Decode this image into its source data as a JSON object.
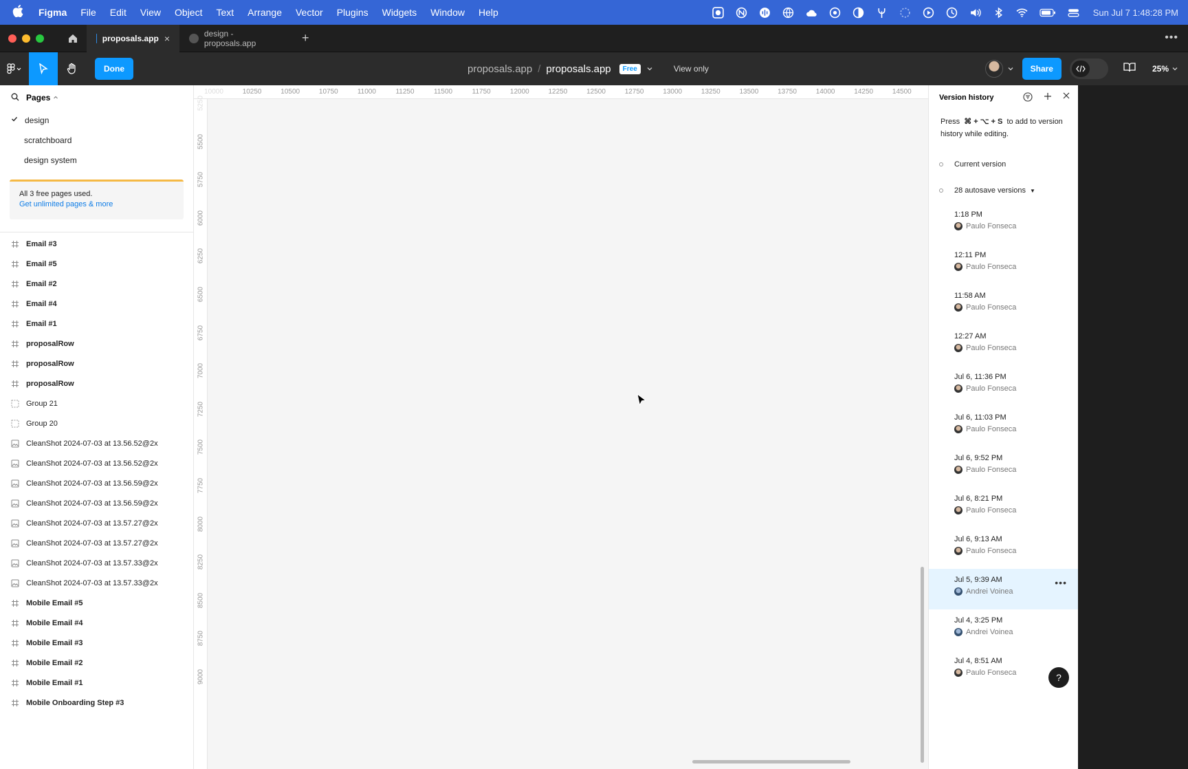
{
  "menubar": {
    "app": "Figma",
    "items": [
      "File",
      "Edit",
      "View",
      "Object",
      "Text",
      "Arrange",
      "Vector",
      "Plugins",
      "Widgets",
      "Window",
      "Help"
    ],
    "clock": "Sun Jul 7  1:48:28 PM",
    "tray_icons": [
      "record-icon",
      "vpn-icon",
      "audio-icon",
      "globe-icon",
      "cloud-icon",
      "aperture-icon",
      "contrast-icon",
      "fork-icon",
      "loading-icon",
      "play-icon",
      "clock-icon",
      "volume-icon",
      "bluetooth-icon",
      "wifi-icon",
      "battery-icon",
      "control-center-icon"
    ]
  },
  "tabs": {
    "active": "proposals.app",
    "inactive": "design - proposals.app",
    "close_glyph": "×",
    "add_glyph": "+",
    "more_glyph": "•••"
  },
  "toolbar": {
    "done_label": "Done",
    "team": "proposals.app",
    "separator": "/",
    "file_name": "proposals.app",
    "plan_badge": "Free",
    "view_mode": "View only",
    "share_label": "Share",
    "zoom": "25%",
    "accent": "#0d99ff"
  },
  "left": {
    "pages_title": "Pages",
    "pages": [
      {
        "name": "design",
        "current": true
      },
      {
        "name": "scratchboard",
        "current": false
      },
      {
        "name": "design system",
        "current": false
      }
    ],
    "upgrade_text": "All 3 free pages used.",
    "upgrade_link": "Get unlimited pages & more",
    "layers": [
      {
        "name": "Email #3",
        "type": "frame"
      },
      {
        "name": "Email #5",
        "type": "frame"
      },
      {
        "name": "Email #2",
        "type": "frame"
      },
      {
        "name": "Email #4",
        "type": "frame"
      },
      {
        "name": "Email #1",
        "type": "frame"
      },
      {
        "name": "proposalRow",
        "type": "frame"
      },
      {
        "name": "proposalRow",
        "type": "frame"
      },
      {
        "name": "proposalRow",
        "type": "frame"
      },
      {
        "name": "Group 21",
        "type": "group"
      },
      {
        "name": "Group 20",
        "type": "group"
      },
      {
        "name": "CleanShot 2024-07-03 at 13.56.52@2x",
        "type": "image"
      },
      {
        "name": "CleanShot 2024-07-03 at 13.56.52@2x",
        "type": "image"
      },
      {
        "name": "CleanShot 2024-07-03 at 13.56.59@2x",
        "type": "image"
      },
      {
        "name": "CleanShot 2024-07-03 at 13.56.59@2x",
        "type": "image"
      },
      {
        "name": "CleanShot 2024-07-03 at 13.57.27@2x",
        "type": "image"
      },
      {
        "name": "CleanShot 2024-07-03 at 13.57.27@2x",
        "type": "image"
      },
      {
        "name": "CleanShot 2024-07-03 at 13.57.33@2x",
        "type": "image"
      },
      {
        "name": "CleanShot 2024-07-03 at 13.57.33@2x",
        "type": "image"
      },
      {
        "name": "Mobile Email #5",
        "type": "frame"
      },
      {
        "name": "Mobile Email #4",
        "type": "frame"
      },
      {
        "name": "Mobile Email #3",
        "type": "frame"
      },
      {
        "name": "Mobile Email #2",
        "type": "frame"
      },
      {
        "name": "Mobile Email #1",
        "type": "frame"
      },
      {
        "name": "Mobile Onboarding Step #3",
        "type": "frame"
      }
    ]
  },
  "canvas": {
    "ruler_x": [
      "10000",
      "10250",
      "10500",
      "10750",
      "11000",
      "11250",
      "11500",
      "11750",
      "12000",
      "12250",
      "12500",
      "12750",
      "13000",
      "13250",
      "13500",
      "13750",
      "14000",
      "14250",
      "14500"
    ],
    "ruler_y": [
      "5250",
      "5500",
      "5750",
      "6000",
      "6250",
      "6500",
      "6750",
      "7000",
      "7250",
      "7500",
      "7750",
      "8000",
      "8250",
      "8500",
      "8750",
      "9000"
    ]
  },
  "right": {
    "title": "Version history",
    "hint_pre": "Press",
    "hint_keys": "⌘ + ⌥ + S",
    "hint_post": "to add to version history while editing.",
    "current_version": "Current version",
    "autosave": "28 autosave versions",
    "versions": [
      {
        "time": "1:18 PM",
        "user": "Paulo Fonseca",
        "highlight": false
      },
      {
        "time": "12:11 PM",
        "user": "Paulo Fonseca",
        "highlight": false
      },
      {
        "time": "11:58 AM",
        "user": "Paulo Fonseca",
        "highlight": false
      },
      {
        "time": "12:27 AM",
        "user": "Paulo Fonseca",
        "highlight": false
      },
      {
        "time": "Jul 6, 11:36 PM",
        "user": "Paulo Fonseca",
        "highlight": false
      },
      {
        "time": "Jul 6, 11:03 PM",
        "user": "Paulo Fonseca",
        "highlight": false
      },
      {
        "time": "Jul 6, 9:52 PM",
        "user": "Paulo Fonseca",
        "highlight": false
      },
      {
        "time": "Jul 6, 8:21 PM",
        "user": "Paulo Fonseca",
        "highlight": false
      },
      {
        "time": "Jul 6, 9:13 AM",
        "user": "Paulo Fonseca",
        "highlight": false
      },
      {
        "time": "Jul 5, 9:39 AM",
        "user": "Andrei Voinea",
        "highlight": true
      },
      {
        "time": "Jul 4, 3:25 PM",
        "user": "Andrei Voinea",
        "highlight": false
      },
      {
        "time": "Jul 4, 8:51 AM",
        "user": "Paulo Fonseca",
        "highlight": false
      }
    ],
    "more_glyph": "•••",
    "help_glyph": "?"
  }
}
